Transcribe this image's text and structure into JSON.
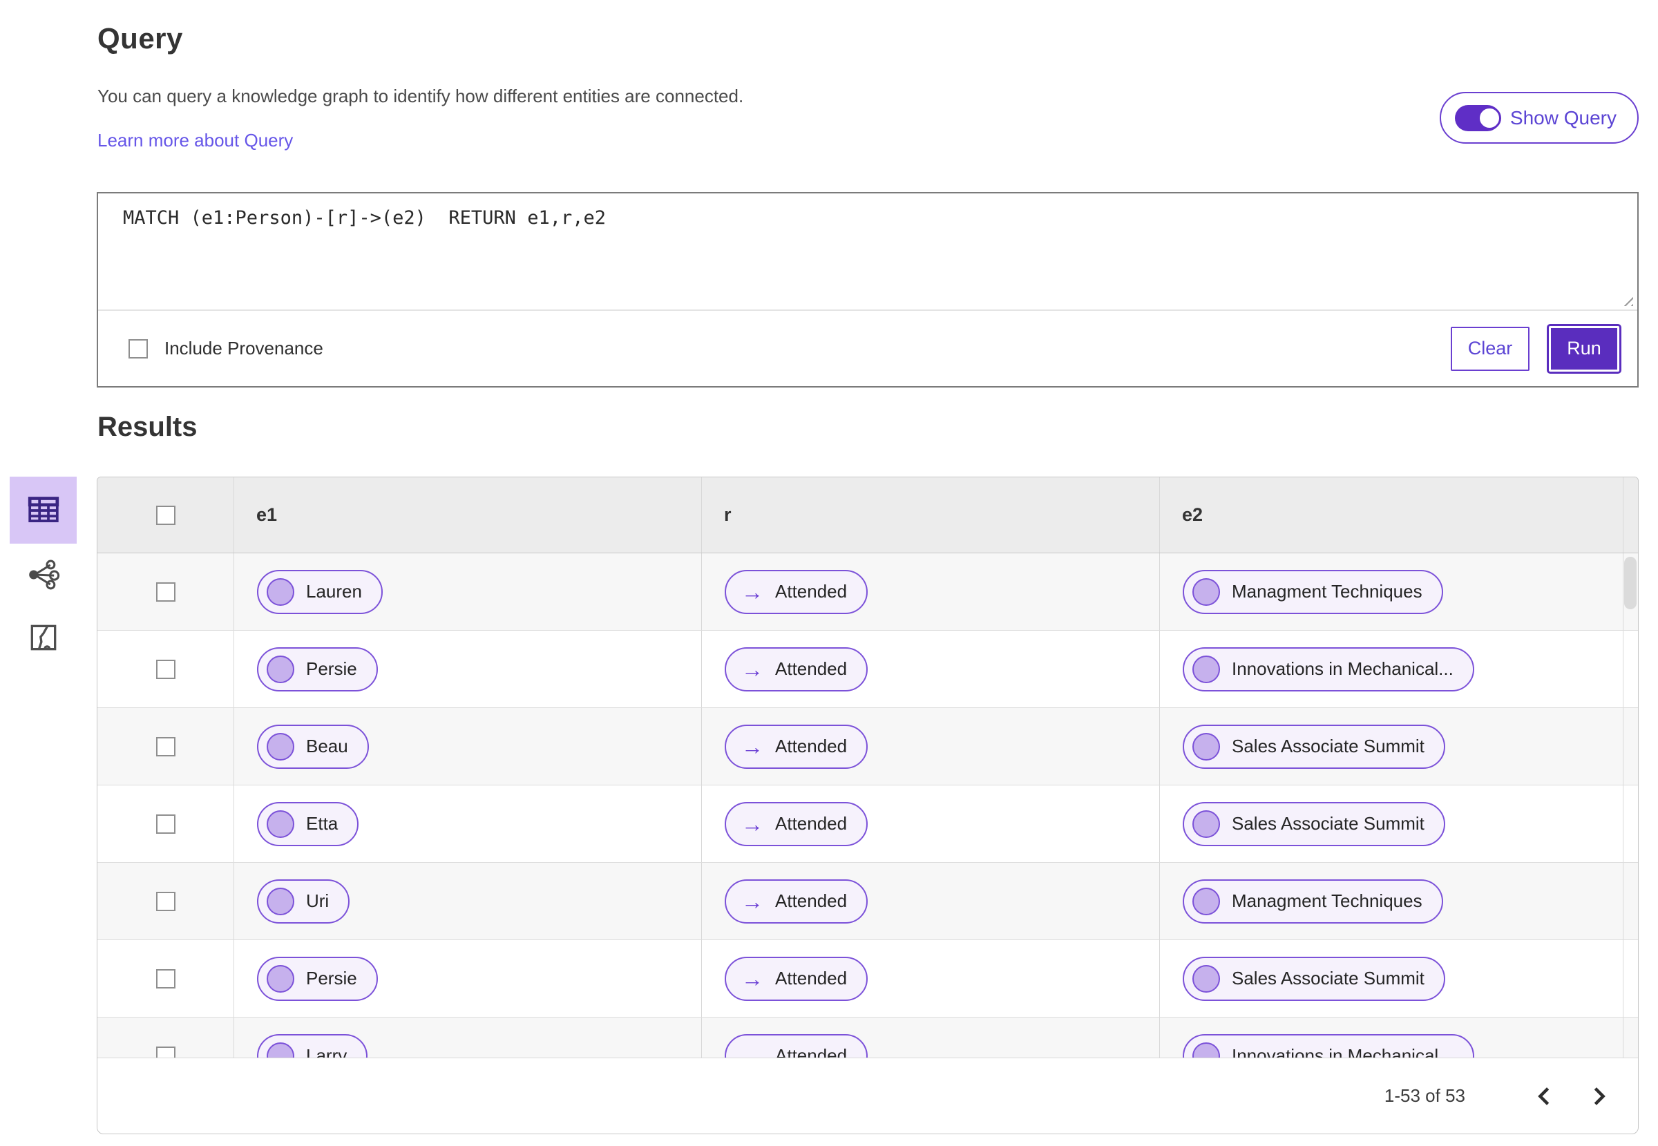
{
  "query_section": {
    "title": "Query",
    "description": "You can query a knowledge graph to identify how different entities are connected.",
    "learn_more_label": "Learn more about Query",
    "show_query_label": "Show Query",
    "show_query_state": "on",
    "query_text": "MATCH (e1:Person)-[r]->(e2)  RETURN e1,r,e2",
    "include_provenance_label": "Include Provenance",
    "include_provenance_checked": false,
    "clear_label": "Clear",
    "run_label": "Run"
  },
  "results_section": {
    "title": "Results",
    "columns": [
      "e1",
      "r",
      "e2"
    ],
    "rows": [
      {
        "e1": "Lauren",
        "r": "Attended",
        "e2": "Managment Techniques"
      },
      {
        "e1": "Persie",
        "r": "Attended",
        "e2": "Innovations in Mechanical..."
      },
      {
        "e1": "Beau",
        "r": "Attended",
        "e2": "Sales Associate Summit"
      },
      {
        "e1": "Etta",
        "r": "Attended",
        "e2": "Sales Associate Summit"
      },
      {
        "e1": "Uri",
        "r": "Attended",
        "e2": "Managment Techniques"
      },
      {
        "e1": "Persie",
        "r": "Attended",
        "e2": "Sales Associate Summit"
      },
      {
        "e1": "Larry",
        "r": "Attended",
        "e2": "Innovations in Mechanical..."
      }
    ],
    "pagination": {
      "range_label": "1-53 of 53"
    }
  },
  "view_rail": {
    "items": [
      {
        "name": "table-view",
        "icon": "table-icon",
        "selected": true
      },
      {
        "name": "graph-view",
        "icon": "network-graph-icon",
        "selected": false
      },
      {
        "name": "map-view",
        "icon": "map-route-icon",
        "selected": false
      }
    ]
  },
  "icons": {
    "relationship_arrow": "→"
  },
  "colors": {
    "accent_purple": "#5a2dbe",
    "toggle_purple": "#5f2ec6",
    "pill_border": "#7c52d9",
    "pill_background": "#f6f2fc",
    "node_circle_fill": "#c6b1ed",
    "link_color": "#6656e8",
    "selected_rail_background": "#d8c6f6",
    "table_header_background": "#ececec",
    "striped_row_background": "#f7f7f7"
  }
}
